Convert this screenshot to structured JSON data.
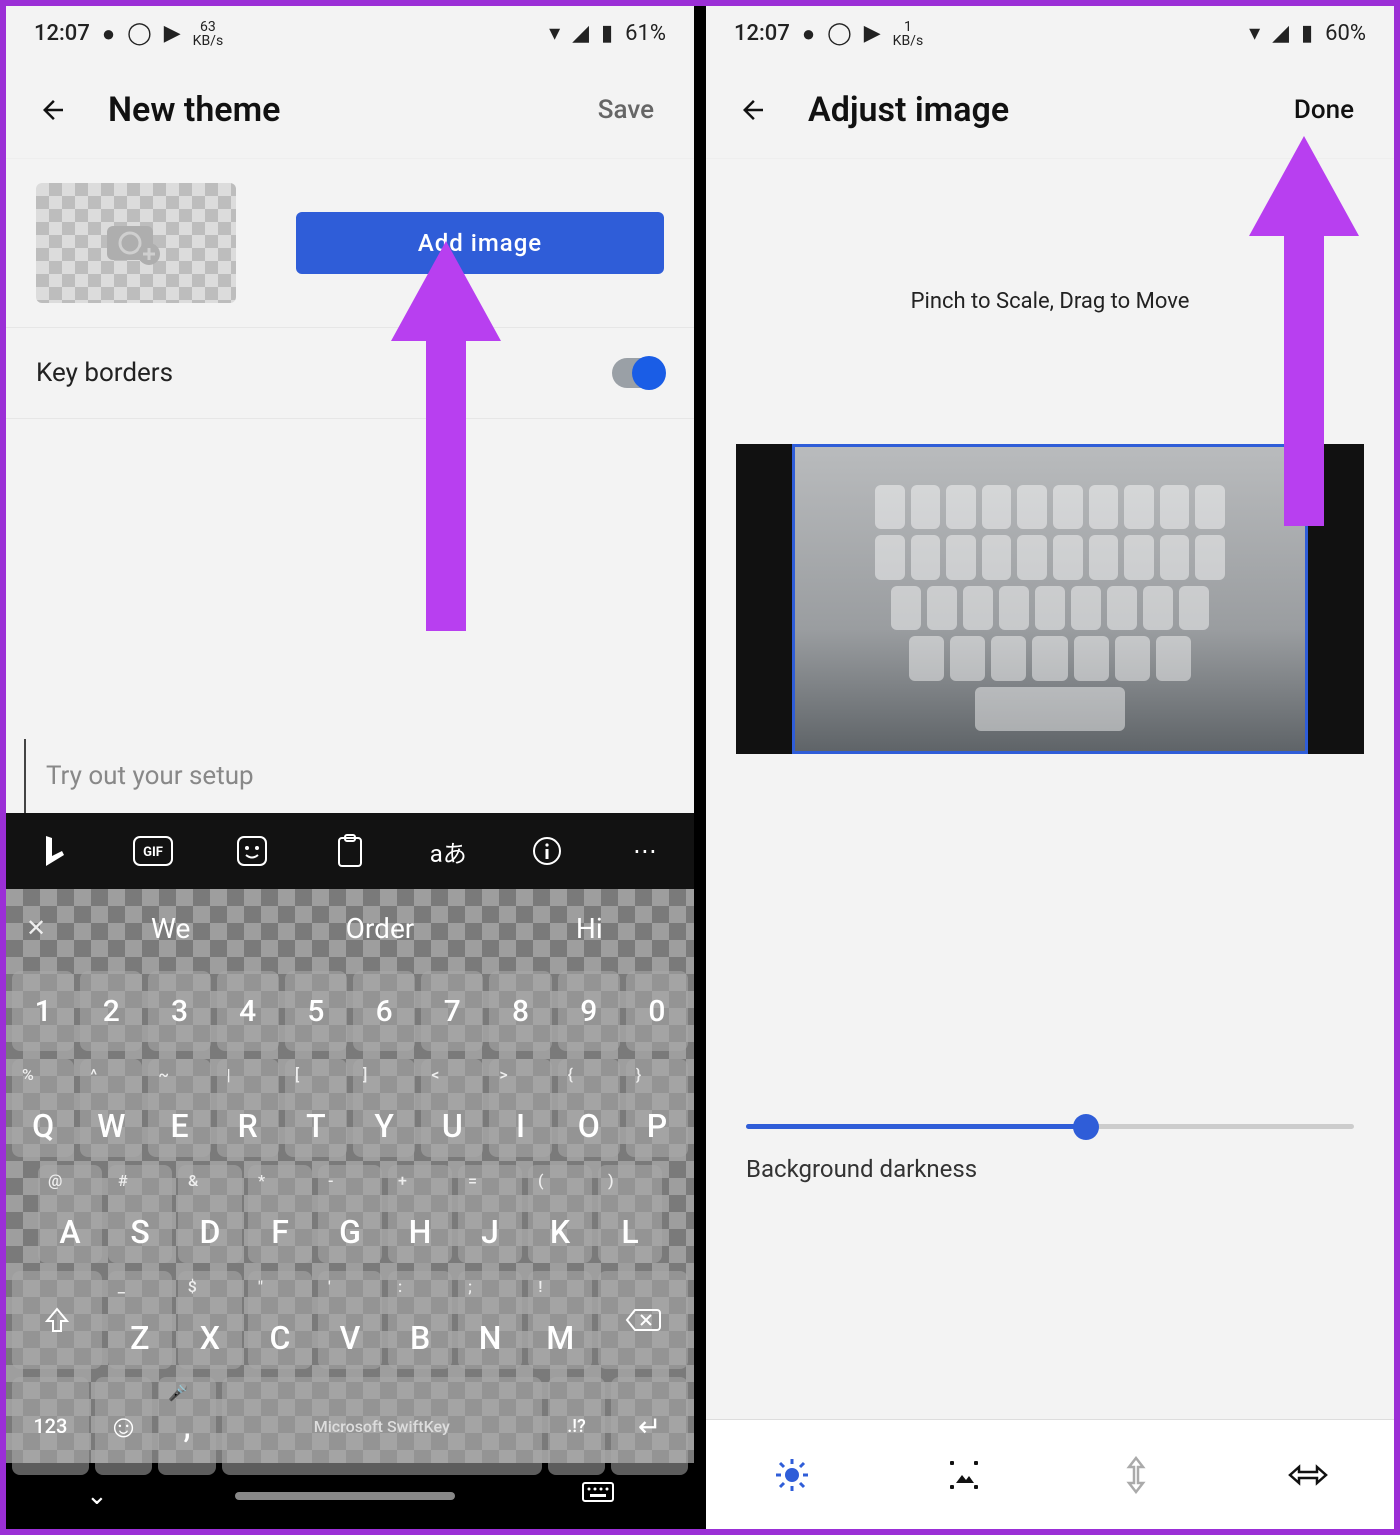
{
  "left": {
    "status": {
      "time": "12:07",
      "kbps": "63",
      "kbps_unit": "KB/s",
      "battery": "61%"
    },
    "title": "New theme",
    "action": "Save",
    "add_image": "Add image",
    "toggle_label": "Key borders",
    "tryout_placeholder": "Try out your setup",
    "suggestions": {
      "close": "✕",
      "s1": "We",
      "s2": "Order",
      "s3": "Hi"
    },
    "numrow": [
      "1",
      "2",
      "3",
      "4",
      "5",
      "6",
      "7",
      "8",
      "9",
      "0"
    ],
    "row1_sup": [
      "%",
      "^",
      "~",
      "|",
      "[",
      "]",
      "<",
      ">",
      "{",
      "}"
    ],
    "row1": [
      "Q",
      "W",
      "E",
      "R",
      "T",
      "Y",
      "U",
      "I",
      "O",
      "P"
    ],
    "row2_sup": [
      "@",
      "#",
      "&",
      "*",
      "-",
      "+",
      "=",
      "(",
      ")"
    ],
    "row2": [
      "A",
      "S",
      "D",
      "F",
      "G",
      "H",
      "J",
      "K",
      "L"
    ],
    "row3_sup": [
      "_",
      "$",
      "\"",
      "'",
      ":",
      ";",
      "!"
    ],
    "row3": [
      "Z",
      "X",
      "C",
      "V",
      "B",
      "N",
      "M"
    ],
    "bottom": {
      "numkey": "123",
      "comma": ",",
      "space": "Microsoft SwiftKey",
      "period": ".!?",
      "enter": "↵"
    }
  },
  "right": {
    "status": {
      "time": "12:07",
      "kbps": "1",
      "kbps_unit": "KB/s",
      "battery": "60%"
    },
    "title": "Adjust image",
    "action": "Done",
    "hint": "Pinch to Scale, Drag to Move",
    "slider_label": "Background darkness"
  }
}
